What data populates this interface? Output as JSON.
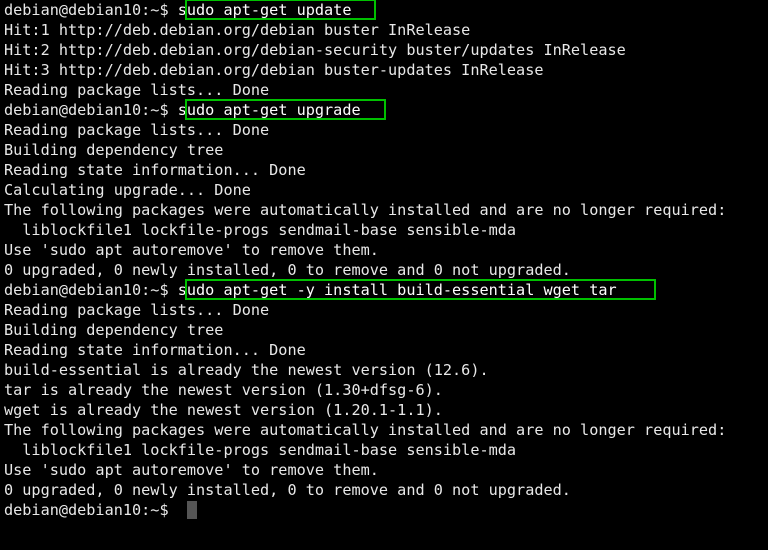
{
  "terminal": {
    "background_color": "#000000",
    "foreground_color": "#e8e8e8",
    "highlight_color": "#00c000",
    "cursor_color": "#555555",
    "prompt": "debian@debian10:~$ ",
    "lines": [
      {
        "type": "prompt",
        "prompt": "debian@debian10:~$ ",
        "command": "sudo apt-get update",
        "highlighted": true
      },
      {
        "type": "output",
        "text": "Hit:1 http://deb.debian.org/debian buster InRelease"
      },
      {
        "type": "output",
        "text": "Hit:2 http://deb.debian.org/debian-security buster/updates InRelease"
      },
      {
        "type": "output",
        "text": "Hit:3 http://deb.debian.org/debian buster-updates InRelease"
      },
      {
        "type": "output",
        "text": "Reading package lists... Done"
      },
      {
        "type": "prompt",
        "prompt": "debian@debian10:~$ ",
        "command": "sudo apt-get upgrade",
        "highlighted": true
      },
      {
        "type": "output",
        "text": "Reading package lists... Done"
      },
      {
        "type": "output",
        "text": "Building dependency tree"
      },
      {
        "type": "output",
        "text": "Reading state information... Done"
      },
      {
        "type": "output",
        "text": "Calculating upgrade... Done"
      },
      {
        "type": "output",
        "text": "The following packages were automatically installed and are no longer required:"
      },
      {
        "type": "output",
        "text": "  liblockfile1 lockfile-progs sendmail-base sensible-mda"
      },
      {
        "type": "output",
        "text": "Use 'sudo apt autoremove' to remove them."
      },
      {
        "type": "output",
        "text": "0 upgraded, 0 newly installed, 0 to remove and 0 not upgraded."
      },
      {
        "type": "prompt",
        "prompt": "debian@debian10:~$ ",
        "command": "sudo apt-get -y install build-essential wget tar",
        "highlighted": true
      },
      {
        "type": "output",
        "text": "Reading package lists... Done"
      },
      {
        "type": "output",
        "text": "Building dependency tree"
      },
      {
        "type": "output",
        "text": "Reading state information... Done"
      },
      {
        "type": "output",
        "text": "build-essential is already the newest version (12.6)."
      },
      {
        "type": "output",
        "text": "tar is already the newest version (1.30+dfsg-6)."
      },
      {
        "type": "output",
        "text": "wget is already the newest version (1.20.1-1.1)."
      },
      {
        "type": "output",
        "text": "The following packages were automatically installed and are no longer required:"
      },
      {
        "type": "output",
        "text": "  liblockfile1 lockfile-progs sendmail-base sensible-mda"
      },
      {
        "type": "output",
        "text": "Use 'sudo apt autoremove' to remove them."
      },
      {
        "type": "output",
        "text": "0 upgraded, 0 newly installed, 0 to remove and 0 not upgraded."
      },
      {
        "type": "prompt",
        "prompt": "debian@debian10:~$ ",
        "command": "",
        "highlighted": false,
        "cursor": true
      }
    ]
  }
}
